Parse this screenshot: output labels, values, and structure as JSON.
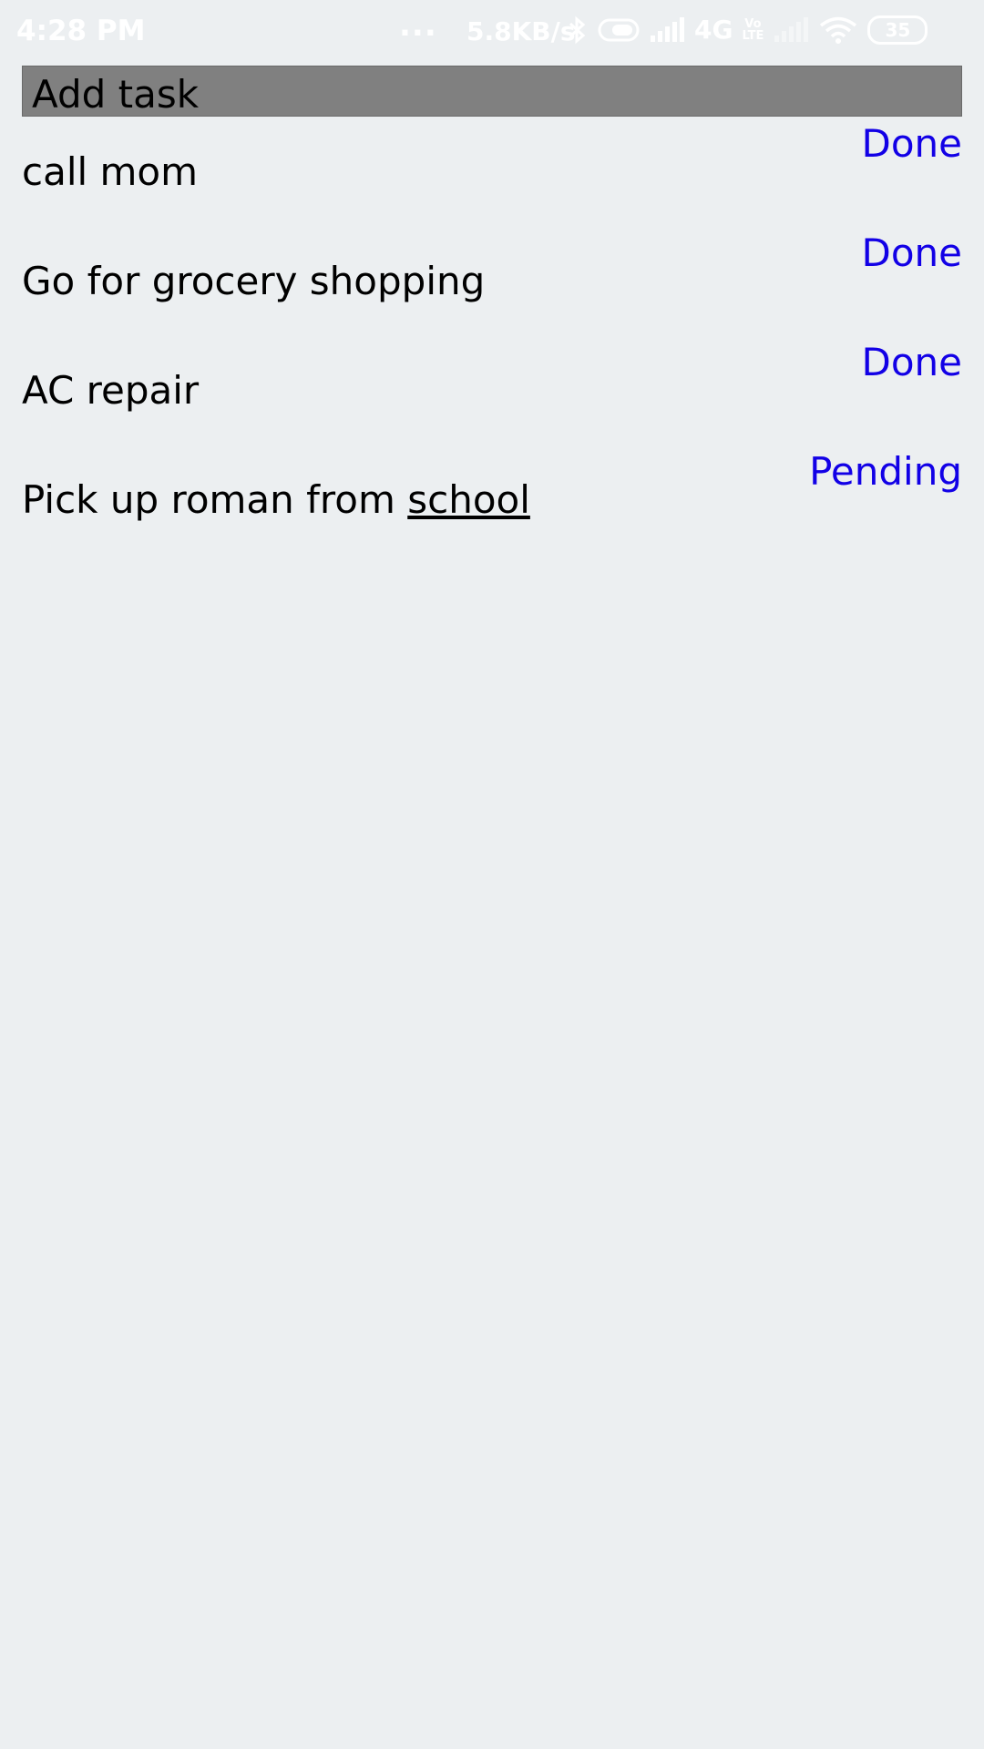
{
  "status_bar": {
    "time": "4:28 PM",
    "dots": "...",
    "speed": "5.8KB/s",
    "network": "4G",
    "volte": "Vo\nLTE",
    "battery": "35",
    "icons": [
      "bluetooth-icon",
      "toggle-icon",
      "signal-icon",
      "volte-icon",
      "signal-weak-icon",
      "wifi-icon",
      "battery-icon"
    ]
  },
  "header": {
    "add_task_label": "Add task"
  },
  "tasks": [
    {
      "text": "call mom",
      "status": "Done"
    },
    {
      "text": "Go for grocery shopping",
      "status": "Done"
    },
    {
      "text": "AC repair",
      "status": "Done"
    },
    {
      "text_prefix": "Pick up roman from ",
      "text_underlined": "school",
      "status": "Pending"
    }
  ],
  "colors": {
    "background": "#eceff1",
    "add_task_bar": "#808080",
    "status_text": "#1200e6"
  }
}
